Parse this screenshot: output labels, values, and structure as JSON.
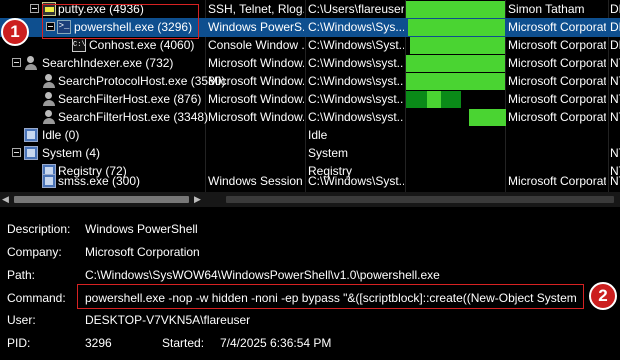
{
  "process_tree": {
    "rows": [
      {
        "name": "putty.exe (4936)",
        "description": "SSH, Telnet, Rlog...",
        "path": "C:\\Users\\flareuser...",
        "company": "Simon Tatham",
        "extra": "DE"
      },
      {
        "name": "powershell.exe (3296)",
        "description": "Windows PowerS...",
        "path": "C:\\Windows\\Sys...",
        "company": "Microsoft Corporat...",
        "extra": "DE"
      },
      {
        "name": "Conhost.exe (4060)",
        "description": "Console Window ...",
        "path": "C:\\Windows\\Syst...",
        "company": "Microsoft Corporat...",
        "extra": "DE"
      },
      {
        "name": "SearchIndexer.exe (732)",
        "description": "Microsoft Window...",
        "path": "C:\\Windows\\syst...",
        "company": "Microsoft Corporat...",
        "extra": "NT"
      },
      {
        "name": "SearchProtocolHost.exe (3580)",
        "description": "Microsoft Window...",
        "path": "C:\\Windows\\syst...",
        "company": "Microsoft Corporat...",
        "extra": "NT"
      },
      {
        "name": "SearchFilterHost.exe (876)",
        "description": "Microsoft Window...",
        "path": "C:\\Windows\\syst...",
        "company": "Microsoft Corporat...",
        "extra": "NT"
      },
      {
        "name": "SearchFilterHost.exe (3348)",
        "description": "Microsoft Window...",
        "path": "C:\\Windows\\syst...",
        "company": "Microsoft Corporat...",
        "extra": "NT"
      },
      {
        "name": "Idle (0)",
        "description": "",
        "path": "Idle",
        "company": "",
        "extra": ""
      },
      {
        "name": "System (4)",
        "description": "",
        "path": "System",
        "company": "",
        "extra": "NT"
      },
      {
        "name": "Registry (72)",
        "description": "",
        "path": "Registry",
        "company": "",
        "extra": "NT"
      },
      {
        "name": "smss.exe (300)",
        "description": "Windows Session ...",
        "path": "C:\\Windows\\Syst...",
        "company": "Microsoft Corporat...",
        "extra": "NT"
      }
    ]
  },
  "details": {
    "description_label": "Description:",
    "description_value": "Windows PowerShell",
    "company_label": "Company:",
    "company_value": "Microsoft Corporation",
    "path_label": "Path:",
    "path_value": "C:\\Windows\\SysWOW64\\WindowsPowerShell\\v1.0\\powershell.exe",
    "command_label": "Command:",
    "command_value": "powershell.exe -nop -w hidden -noni -ep bypass \"&([scriptblock]::create((New-Object System",
    "user_label": "User:",
    "user_value": "DESKTOP-V7VKN5A\\flareuser",
    "pid_label": "PID:",
    "pid_value": "3296",
    "started_label": "Started:",
    "started_value": "7/4/2025 6:36:54 PM"
  },
  "annotations": {
    "badge_1": "1",
    "badge_2": "2",
    "highlight_color": "#d62222"
  },
  "colors": {
    "selection": "#0e4f8f",
    "cpu_bright": "#4ad432",
    "cpu_dark": "#0a8a18"
  }
}
